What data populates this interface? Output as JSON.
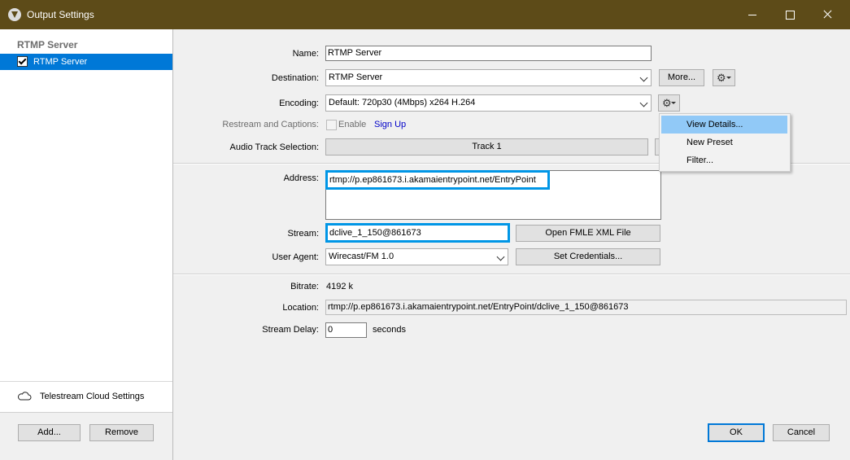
{
  "window": {
    "title": "Output Settings"
  },
  "sidebar": {
    "header": "RTMP Server",
    "items": [
      {
        "label": "RTMP Server",
        "checked": true
      }
    ],
    "cloud_settings": "Telestream Cloud Settings",
    "add_label": "Add...",
    "remove_label": "Remove"
  },
  "form": {
    "name_label": "Name:",
    "name_value": "RTMP Server",
    "destination_label": "Destination:",
    "destination_value": "RTMP Server",
    "more_label": "More...",
    "encoding_label": "Encoding:",
    "encoding_value": "Default: 720p30 (4Mbps) x264 H.264",
    "restream_label": "Restream and Captions:",
    "enable_label": "Enable",
    "signup_label": "Sign Up",
    "audio_track_label": "Audio Track Selection:",
    "audio_track_value": "Track 1",
    "address_label": "Address:",
    "address_value": "rtmp://p.ep861673.i.akamaientrypoint.net/EntryPoint",
    "stream_label": "Stream:",
    "stream_value": "dclive_1_150@861673",
    "open_fmle_label": "Open FMLE XML File",
    "user_agent_label": "User Agent:",
    "user_agent_value": "Wirecast/FM 1.0",
    "set_credentials_label": "Set Credentials...",
    "bitrate_label": "Bitrate:",
    "bitrate_value": "4192 k",
    "location_label": "Location:",
    "location_value": "rtmp://p.ep861673.i.akamaientrypoint.net/EntryPoint/dclive_1_150@861673",
    "stream_delay_label": "Stream Delay:",
    "stream_delay_value": "0",
    "seconds_label": "seconds"
  },
  "encoding_menu": {
    "items": [
      "View Details...",
      "New Preset",
      "Filter..."
    ],
    "highlighted": "View Details..."
  },
  "footer": {
    "ok_label": "OK",
    "cancel_label": "Cancel"
  },
  "colors": {
    "titlebar": "#5d4b18",
    "selection": "#0078d7",
    "highlight_box": "#0096e6",
    "menu_highlight": "#91c9f7"
  }
}
